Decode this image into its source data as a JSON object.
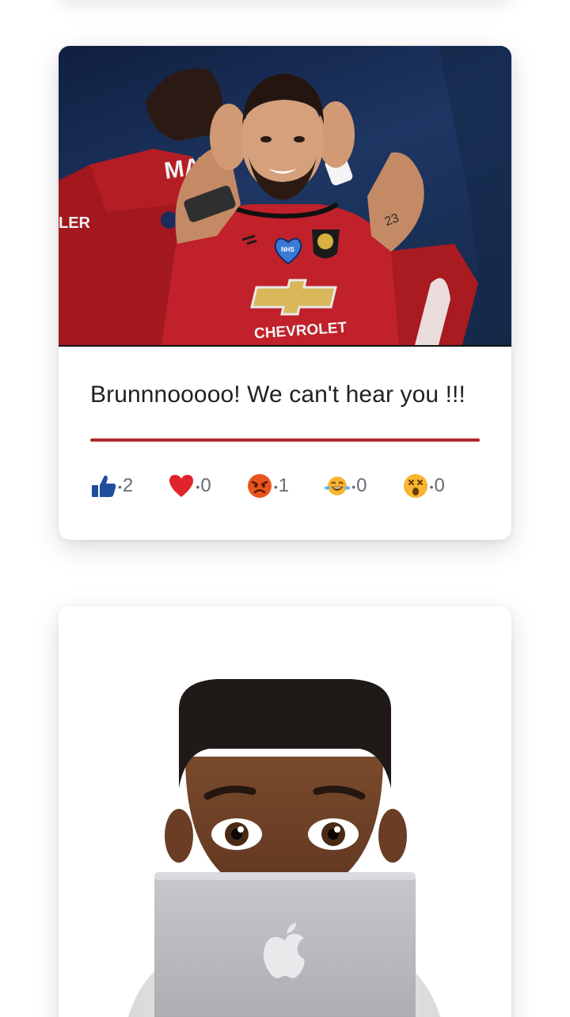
{
  "posts": [
    {
      "image_alt": "Football player in red jersey covering ears",
      "jersey_sponsor": "CHEVROLET",
      "badge_text": "NHS",
      "text": "Brunnnooooo! We can't hear you !!!",
      "accent_color": "#b0282a",
      "reactions": [
        {
          "icon": "thumbs-up-icon",
          "count": "2",
          "color": "#1f4e9c"
        },
        {
          "icon": "heart-icon",
          "count": "0",
          "color": "#e0242b"
        },
        {
          "icon": "angry-face-icon",
          "count": "1",
          "color": "#e8551f"
        },
        {
          "icon": "laughing-face-icon",
          "count": "0",
          "color": "#f7b531"
        },
        {
          "icon": "surprised-face-icon",
          "count": "0",
          "color": "#f7b531"
        }
      ]
    },
    {
      "image_alt": "Memoji avatar behind a laptop"
    }
  ]
}
